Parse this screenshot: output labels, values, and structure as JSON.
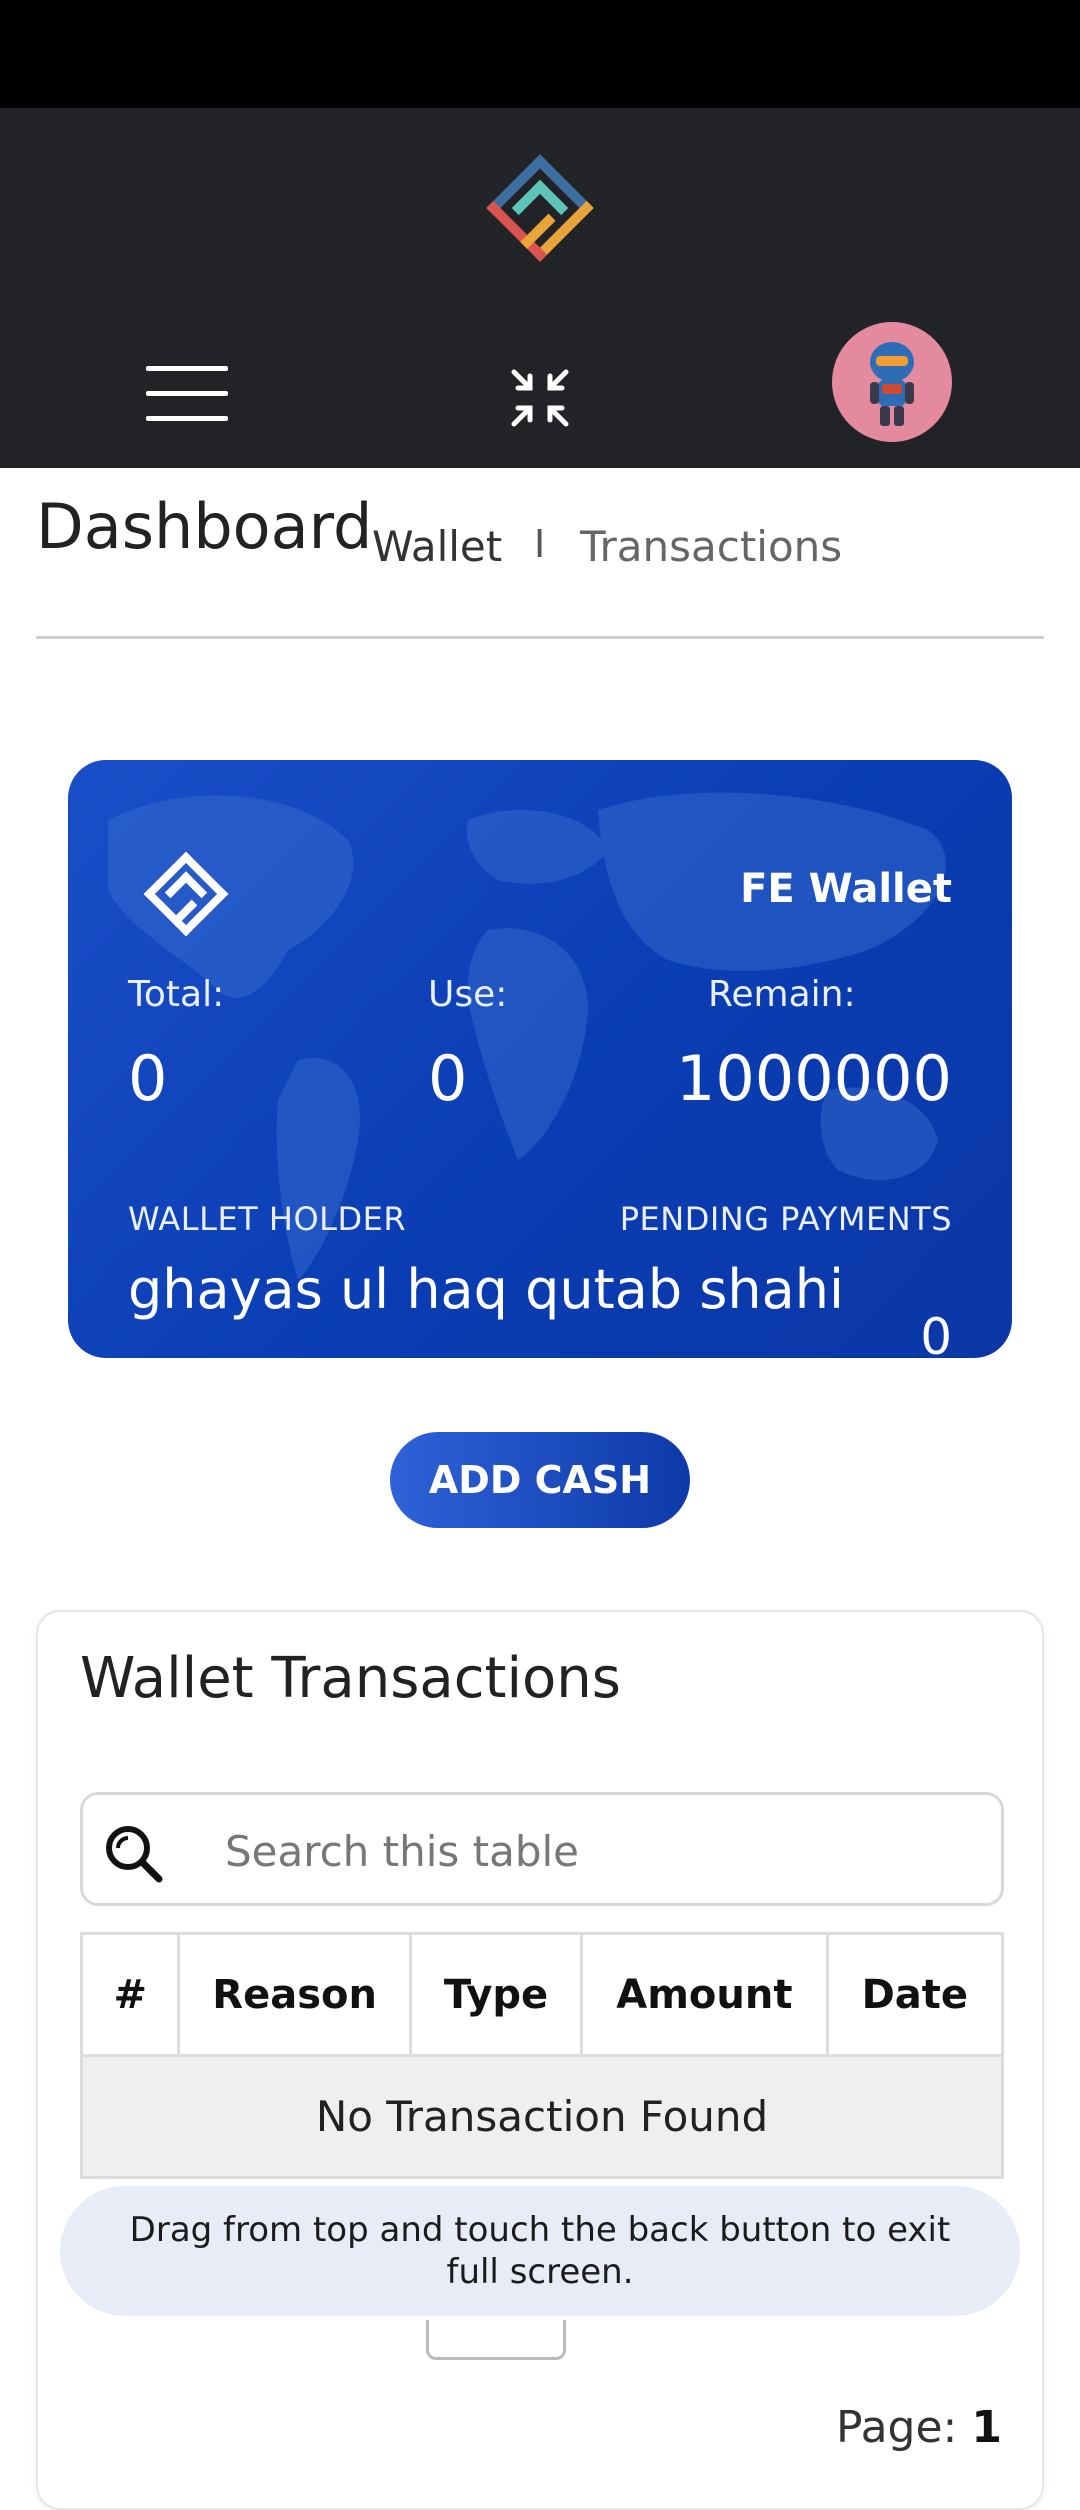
{
  "header": {
    "logo": "fe-logo-icon",
    "menu": "hamburger-menu-icon",
    "fullscreen": "exit-fullscreen-icon",
    "avatar": "robot-avatar"
  },
  "page": {
    "title": "Dashboard",
    "tabs": [
      {
        "label": "Wallet"
      },
      {
        "separator": "I"
      },
      {
        "label": "Transactions"
      }
    ]
  },
  "wallet_card": {
    "name": "FE Wallet",
    "total_label": "Total:",
    "total_value": "0",
    "use_label": "Use:",
    "use_value": "0",
    "remain_label": "Remain:",
    "remain_value": "1000000",
    "holder_label": "WALLET HOLDER",
    "holder_name": "ghayas ul haq qutab shahi",
    "pending_label": "PENDING PAYMENTS",
    "pending_value": "0"
  },
  "add_cash_label": "ADD CASH",
  "transactions": {
    "title": "Wallet Transactions",
    "search_placeholder": "Search this table",
    "columns": [
      "#",
      "Reason",
      "Type",
      "Amount",
      "Date"
    ],
    "empty_message": "No Transaction Found",
    "page_label": "Page:",
    "page_number": "1"
  },
  "toast": "Drag from top and touch the back button to exit full screen.",
  "colors": {
    "header_bg": "#212327",
    "card_blue": "#0a3db3",
    "accent_blue": "#2f62d8",
    "toast_bg": "#e7ecf6"
  }
}
